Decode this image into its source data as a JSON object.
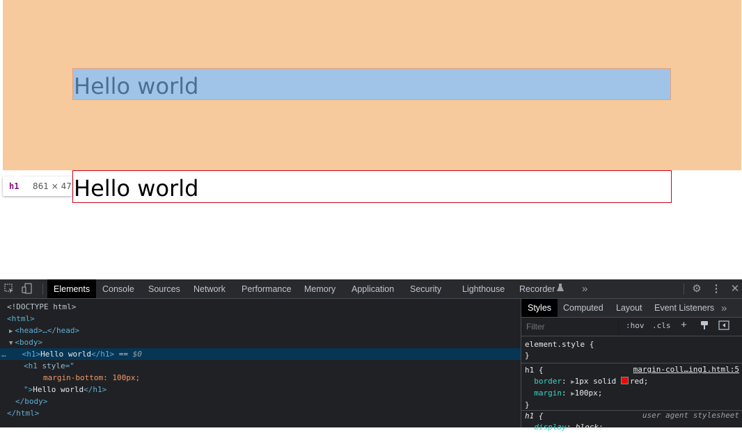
{
  "page": {
    "heading_1": "Hello world",
    "heading_2": "Hello world",
    "tooltip_tag": "h1",
    "tooltip_size": "861 × 47",
    "margin_color": "#f6ca9c",
    "content_color": "#9fc4e7",
    "border_color": "#d0021b"
  },
  "devtools": {
    "tabs": [
      "Elements",
      "Console",
      "Sources",
      "Network",
      "Performance",
      "Memory",
      "Application",
      "Security",
      "Lighthouse",
      "Recorder"
    ],
    "active_tab": "Elements",
    "more_tabs": "»",
    "icons": [
      "inspect-icon",
      "device-toolbar-icon",
      "recorder-flask-icon",
      "gear-icon",
      "kebab-menu-icon",
      "close-icon"
    ],
    "dom": {
      "doctype": "<!DOCTYPE html>",
      "html_open": "<html>",
      "head": "<head>…</head>",
      "body_open": "<body>",
      "h1_open": "<h1>",
      "h1_text": "Hello world",
      "h1_close": "</h1>",
      "eq_sign": " == ",
      "dollar": "$0",
      "ellipsis": "…",
      "h1b_open": "<h1 ",
      "h1b_attr": "style",
      "h1b_eq": "=\"",
      "h1b_style": "margin-bottom: 100px;",
      "h1b_close_quote": "\">",
      "h1b_text": "Hello world",
      "h1b_close": "</h1>",
      "body_close": "</body>",
      "html_close": "</html>"
    },
    "styles": {
      "tabs": [
        "Styles",
        "Computed",
        "Layout",
        "Event Listeners"
      ],
      "active_tab": "Styles",
      "more_tabs": "»",
      "filter_placeholder": "Filter",
      "hov": ":hov",
      "cls": ".cls",
      "plus": "+",
      "element_style_open": "element.style {",
      "close_brace": "}",
      "rule1_selector": "h1 {",
      "rule1_source": "margin-coll…ing1.html:5",
      "rule1_prop1": "border",
      "rule1_val1": "1px solid ",
      "rule1_color": "red",
      "rule1_swatch": "#ff0000",
      "rule1_prop2": "margin",
      "rule1_val2": "100px;",
      "rule2_selector": "h1 {",
      "rule2_source": "user agent stylesheet",
      "rule2_prop1": "display",
      "rule2_val1": "block;"
    }
  }
}
